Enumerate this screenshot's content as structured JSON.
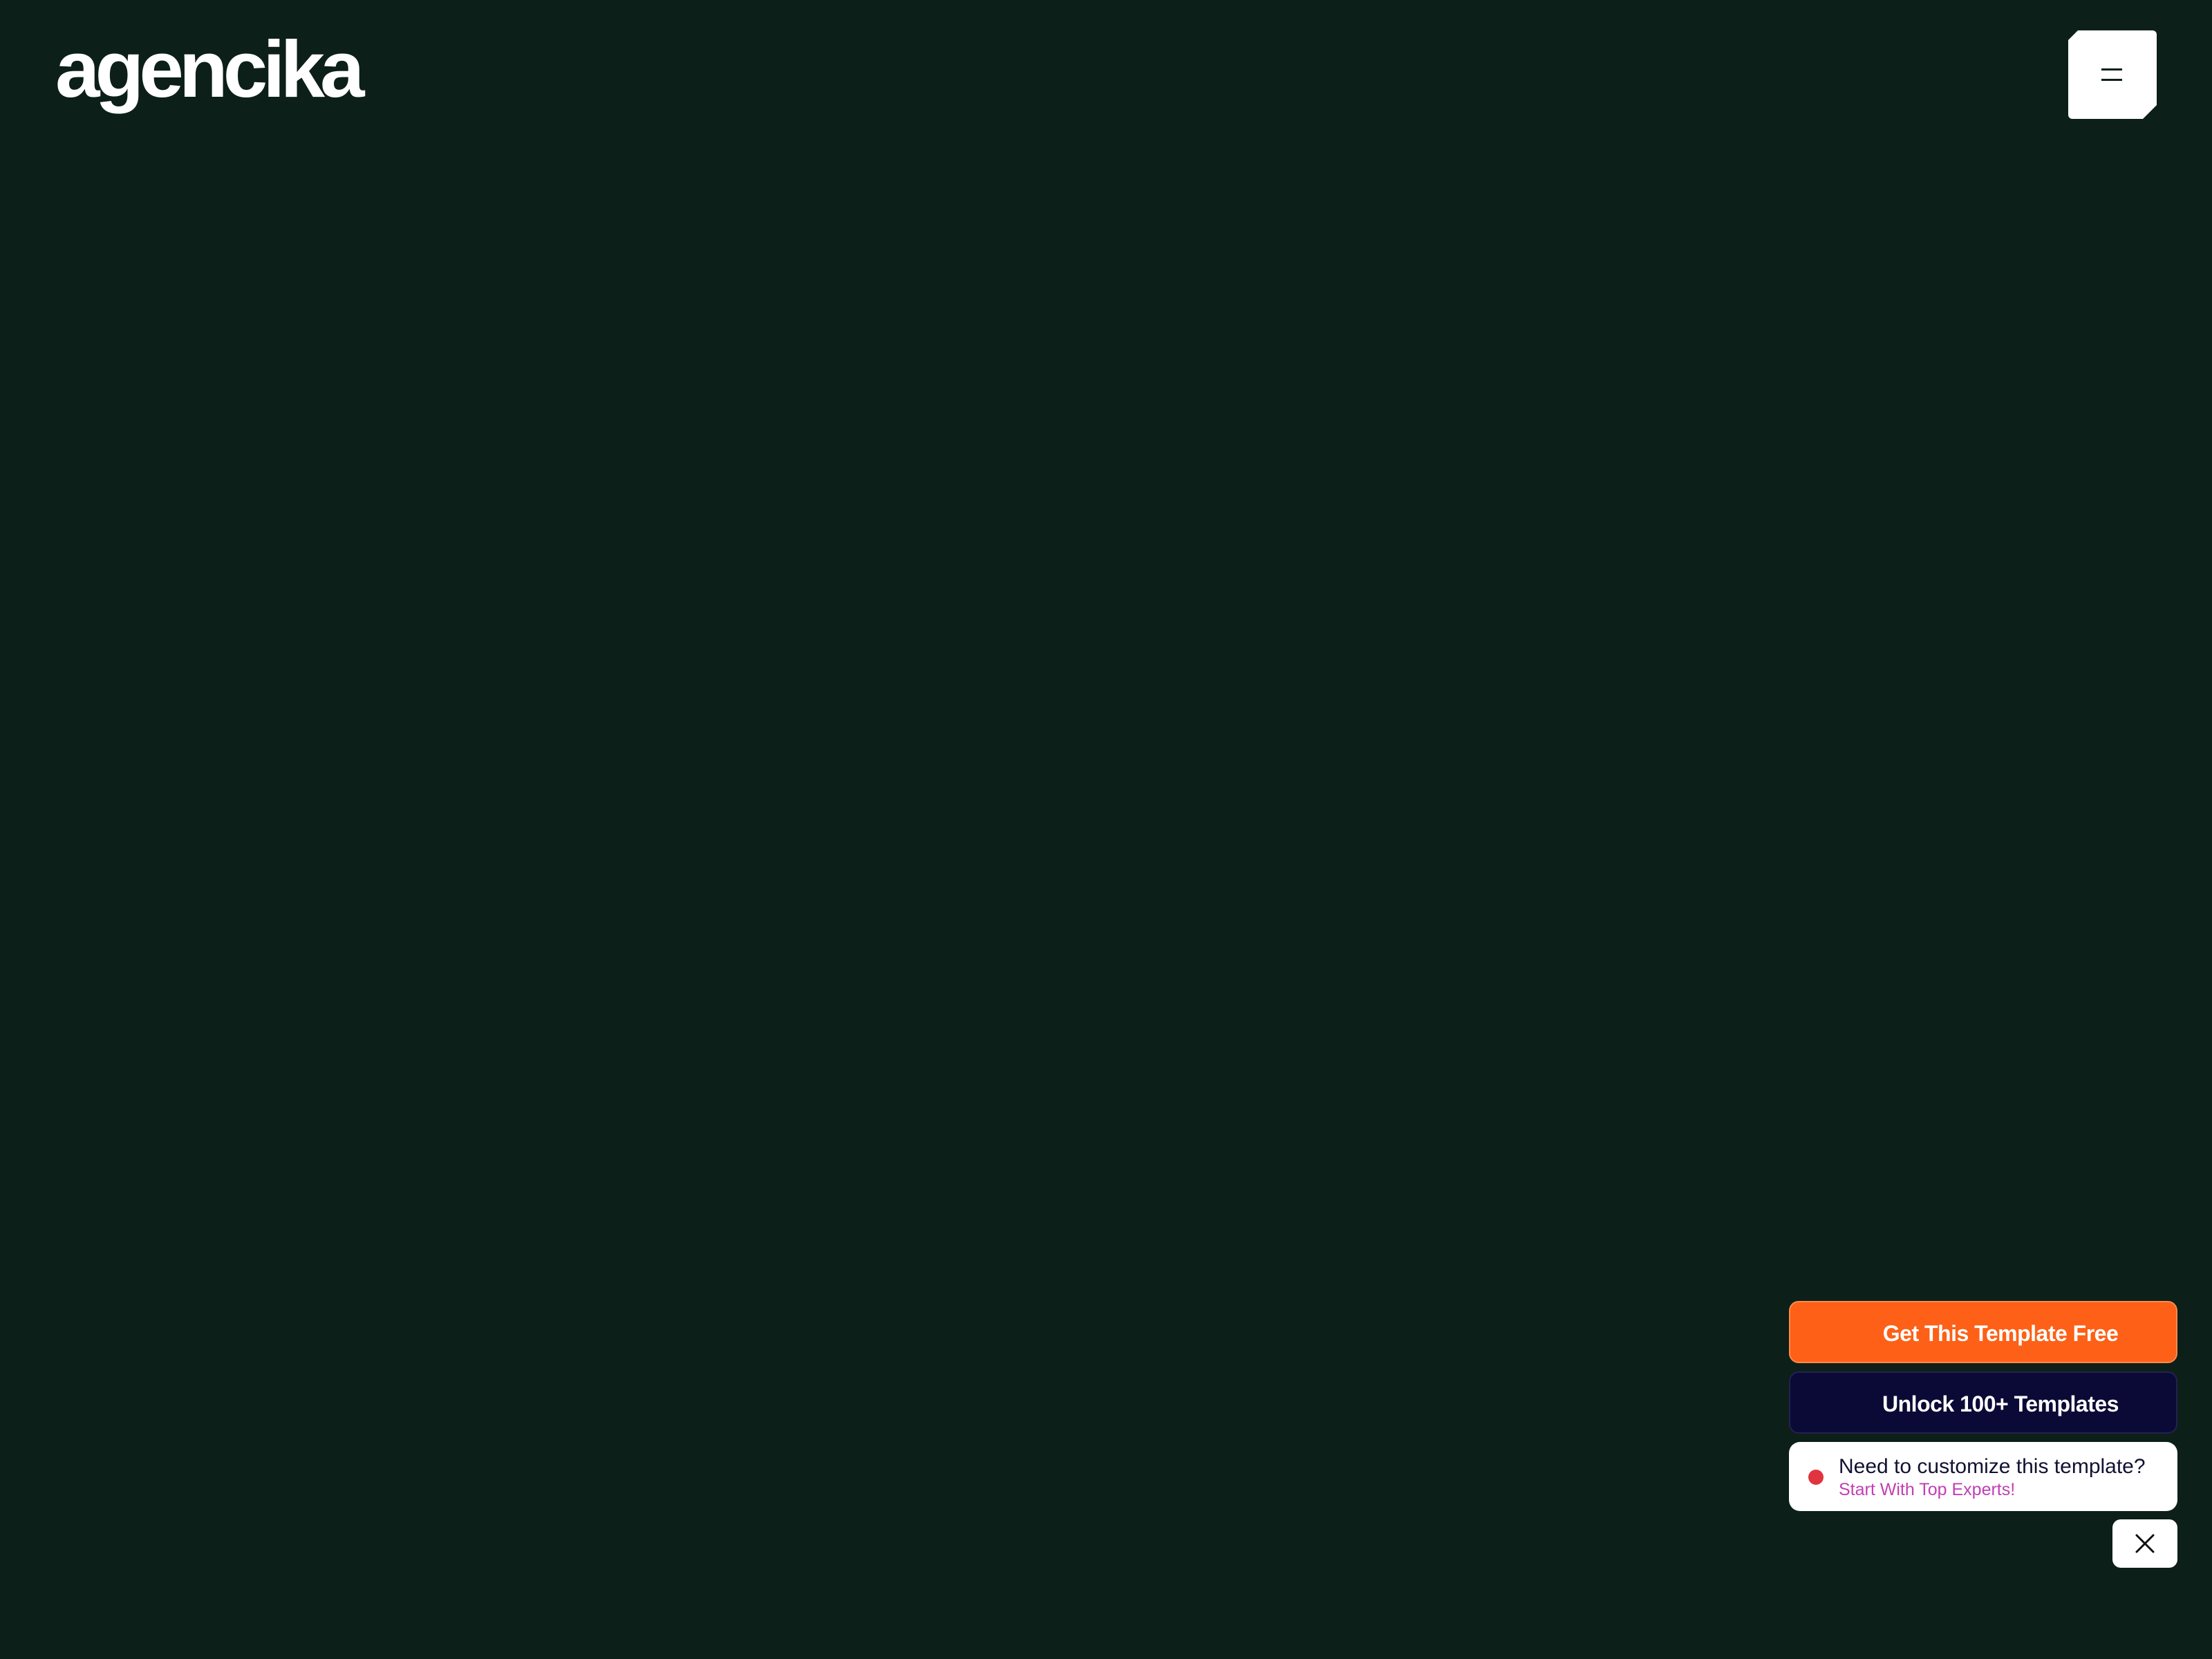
{
  "header": {
    "logo_text": "agencika",
    "menu_icon": "hamburger-menu-icon"
  },
  "promo": {
    "get_template_label": "Get This Template Free",
    "unlock_templates_label": "Unlock 100+ Templates",
    "expert_card": {
      "title": "Need to customize this template?",
      "subtitle": "Start With Top Experts!"
    },
    "close_icon": "close-icon"
  },
  "colors": {
    "background": "#0c1f18",
    "orange_button": "#fd6016",
    "navy_button": "#0b0a36",
    "status_dot": "#e0343f",
    "subtitle_pink": "#c23fb3"
  }
}
